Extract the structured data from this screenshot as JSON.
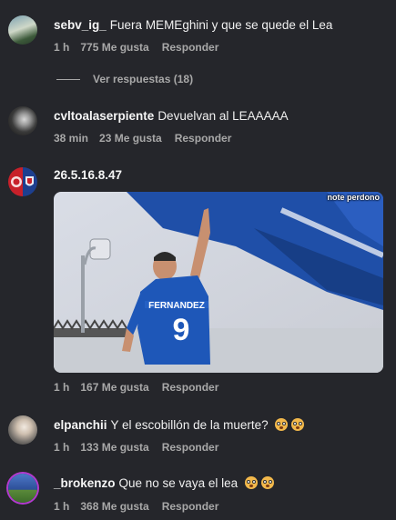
{
  "comments": [
    {
      "user": "sebv_ig_",
      "text": "Fuera MEMEghini y que se quede el Lea",
      "time": "1 h",
      "likes": "775 Me gusta",
      "reply": "Responder"
    },
    {
      "user": "cvltoalaserpiente",
      "text": "Devuelvan al LEAAAAA",
      "time": "38 min",
      "likes": "23 Me gusta",
      "reply": "Responder"
    },
    {
      "user": "26.5.16.8.47",
      "text": "",
      "time": "1 h",
      "likes": "167 Me gusta",
      "reply": "Responder"
    },
    {
      "user": "elpanchii",
      "text": "Y el escobillón de la muerte?",
      "time": "1 h",
      "likes": "133 Me gusta",
      "reply": "Responder"
    },
    {
      "user": "_brokenzo",
      "text": "Que no se vaya el lea",
      "time": "1 h",
      "likes": "368 Me gusta",
      "reply": "Responder"
    }
  ],
  "view_replies": "Ver respuestas (18)",
  "gif": {
    "caption": "note perdono",
    "jersey_name": "FERNANDEZ",
    "jersey_number": "9"
  },
  "colors": {
    "background": "#25262b",
    "meta": "#a8a8a8",
    "jersey": "#1e57b8"
  },
  "icons": {
    "reaction": "flushed-face-emoji"
  }
}
